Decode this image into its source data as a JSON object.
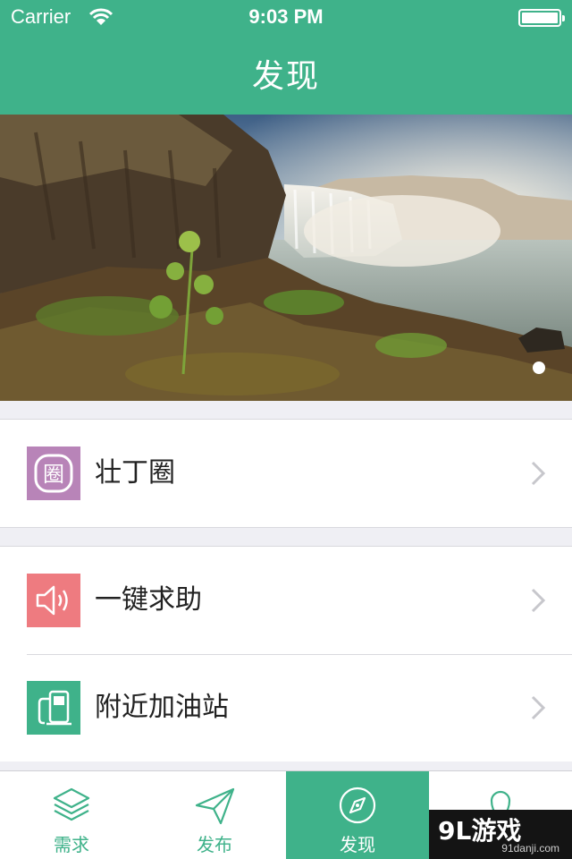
{
  "status_bar": {
    "carrier": "Carrier",
    "time": "9:03 PM"
  },
  "header": {
    "title": "发现"
  },
  "banner": {
    "image": "waterfall landscape",
    "active_page": 1
  },
  "menu": {
    "group1": [
      {
        "label": "壮丁圈",
        "icon": "zhuangding-circle-icon",
        "icon_glyph": "圈",
        "icon_color": "#b884b8"
      }
    ],
    "group2": [
      {
        "label": "一键求助",
        "icon": "speaker-icon",
        "icon_color": "#ee7b80"
      },
      {
        "label": "附近加油站",
        "icon": "gas-pump-icon",
        "icon_color": "#3fb28a"
      }
    ]
  },
  "tabbar": {
    "tabs": [
      {
        "label": "需求",
        "icon": "layers-icon",
        "active": false
      },
      {
        "label": "发布",
        "icon": "paper-plane-icon",
        "active": false
      },
      {
        "label": "发现",
        "icon": "compass-icon",
        "active": true
      },
      {
        "label": "",
        "icon": "location-pin-icon",
        "active": false
      }
    ]
  },
  "watermark": {
    "logo": "9L游戏",
    "url": "91danji.com"
  },
  "colors": {
    "brand": "#3fb28a",
    "background": "#efeff4"
  }
}
